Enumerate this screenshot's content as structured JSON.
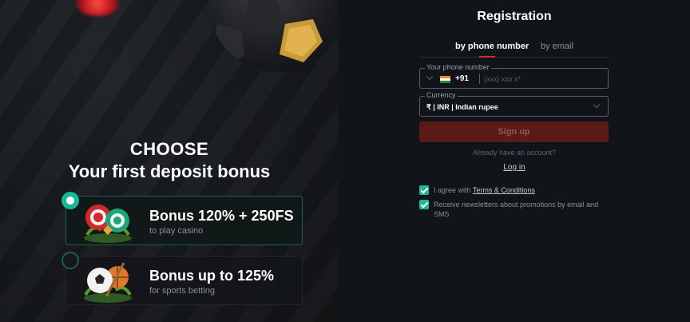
{
  "promo": {
    "heading_line1": "CHOOSE",
    "heading_line2": "Your first deposit bonus",
    "options": [
      {
        "title": "Bonus 120% + 250FS",
        "subtitle": "to play casino",
        "selected": true,
        "icon": "casino-chips-icon"
      },
      {
        "title": "Bonus up to 125%",
        "subtitle": "for sports betting",
        "selected": false,
        "icon": "sports-balls-icon"
      }
    ]
  },
  "registration": {
    "title": "Registration",
    "tabs": [
      {
        "label": "by phone number",
        "active": true
      },
      {
        "label": "by email",
        "active": false
      }
    ],
    "phone": {
      "label": "Your phone number",
      "country_code": "+91",
      "flag": "india-flag-icon",
      "placeholder": "(xxx) xxx x*"
    },
    "currency": {
      "label": "Currency",
      "value": "₹ | INR | Indian rupee"
    },
    "signup_label": "Sign up",
    "already_text": "Already have an account?",
    "login_label": "Log in",
    "terms": {
      "prefix": "I agree with ",
      "link": "Terms & Conditions",
      "checked": true
    },
    "newsletter": {
      "text": "Receive newsletters about promotions by email and SMS",
      "checked": true
    }
  },
  "colors": {
    "accent_green": "#19b896",
    "accent_red": "#d42b2b",
    "signup_bg": "#5a1b16",
    "background": "#111418"
  }
}
